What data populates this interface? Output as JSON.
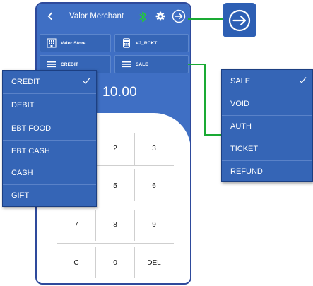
{
  "header": {
    "back_icon": "chevron-left-icon",
    "title": "Valor Merchant",
    "bluetooth_icon": "bluetooth-icon",
    "settings_icon": "gear-icon",
    "logout_icon": "logout-arrow-icon",
    "bluetooth_color": "#22c93a"
  },
  "tiles": {
    "store": "Valor Store",
    "receipt": "VJ_RCKT",
    "payment_type": "CREDIT",
    "transaction_type": "SALE"
  },
  "amount": "10.00",
  "keypad": {
    "k2": "2",
    "k3": "3",
    "k5": "5",
    "k6": "6",
    "k7": "7",
    "k8": "8",
    "k9": "9",
    "kc": "C",
    "k0": "0",
    "kdel": "DEL"
  },
  "payment_menu": {
    "items": [
      "CREDIT",
      "DEBIT",
      "EBT FOOD",
      "EBT CASH",
      "CASH",
      "GIFT"
    ],
    "selected": "CREDIT"
  },
  "transaction_menu": {
    "items": [
      "SALE",
      "VOID",
      "AUTH",
      "TICKET",
      "REFUND"
    ],
    "selected": "SALE"
  },
  "colors": {
    "primary": "#3f6fc4",
    "menu": "#3565b6",
    "callout": "#1aaa34"
  }
}
